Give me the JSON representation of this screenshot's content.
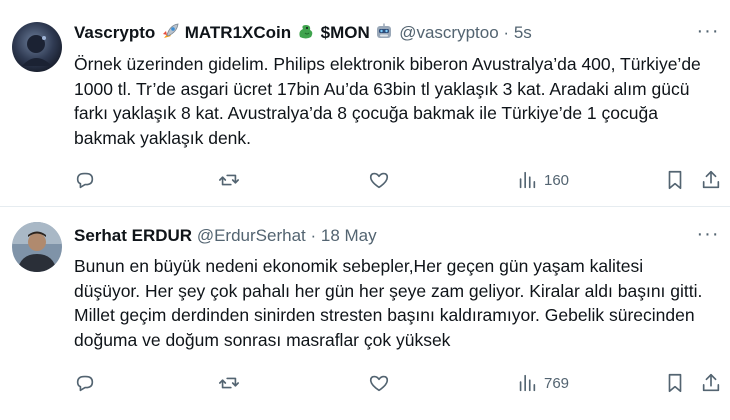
{
  "tweets": [
    {
      "name": "Vascrypto",
      "name_suffix": "MATR1XCoin",
      "name_suffix2": "$MON",
      "handle": "@vascryptoo",
      "separator": "·",
      "time": "5s",
      "text": "Örnek üzerinden gidelim. Philips elektronik biberon Avustralya’da 400, Türkiye’de 1000 tl. Tr’de asgari ücret 17bin Au’da 63bin tl yaklaşık 3 kat. Aradaki alım gücü farkı yaklaşık 8 kat. Avustralya’da 8 çocuğa bakmak ile Türkiye’de 1 çocuğa bakmak yaklaşık denk.",
      "views": "160",
      "icons": {
        "emoji1": "rocket-emoji",
        "emoji2": "dragon-emoji",
        "emoji3": "robot-emoji"
      }
    },
    {
      "name": "Serhat ERDUR",
      "handle": "@ErdurSerhat",
      "separator": "·",
      "time": "18 May",
      "text": "Bunun en büyük nedeni ekonomik sebepler,Her geçen gün yaşam kalitesi düşüyor. Her şey çok pahalı her gün her şeye zam geliyor. Kiralar aldı başını gitti. Millet geçim derdinden sinirden stresten başını kaldıramıyor. Gebelik sürecinden doğuma ve doğum sonrası masraflar çok yüksek",
      "views": "769"
    }
  ],
  "more_glyph": "···",
  "colors": {
    "text": "#0f1419",
    "muted": "#536471",
    "divider": "#e6ecf0"
  }
}
